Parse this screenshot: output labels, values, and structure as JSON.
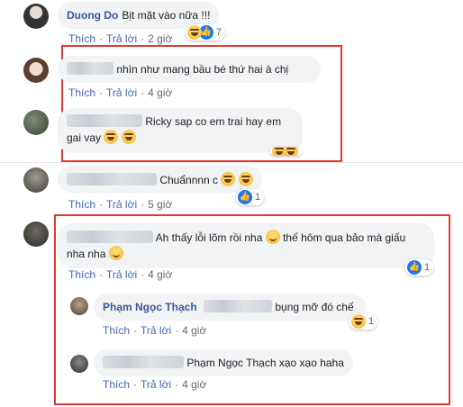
{
  "actions": {
    "like": "Thích",
    "reply": "Trả lời",
    "sep": "·"
  },
  "comments": [
    {
      "author": "Duong Do",
      "text": "Bịt mặt vào nữa !!!",
      "time": "2 giờ",
      "react_count": "7"
    },
    {
      "text": "nhìn như mang bầu bé thứ hai à chị",
      "time": "4 giờ"
    },
    {
      "text_a": "Ricky sap co em trai hay em",
      "text_b": "gai vay",
      "time": "",
      "react_count": ""
    },
    {
      "text": "Chuẩnnnn c",
      "time": "5 giờ",
      "react_count": "1"
    },
    {
      "text_a": "Ah thấy lỗi lõm rồi nha",
      "text_b": "thế hôm qua bảo mà giấu",
      "text_c": "nha nha",
      "time": "4 giờ",
      "react_count": "1"
    },
    {
      "author": "Phạm Ngọc Thạch",
      "text": "bụng mỡ đó chế",
      "time": "4 giờ",
      "react_count": "1"
    },
    {
      "text": "Phạm Ngọc Thạch xạo xạo haha",
      "time": "4 giờ"
    }
  ]
}
